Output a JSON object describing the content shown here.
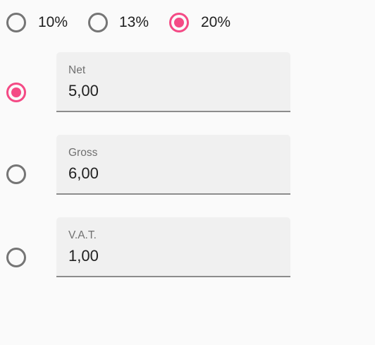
{
  "accent_color": "#f44a85",
  "rates": [
    {
      "label": "10%",
      "selected": false
    },
    {
      "label": "13%",
      "selected": false
    },
    {
      "label": "20%",
      "selected": true
    }
  ],
  "fields": [
    {
      "label": "Net",
      "value": "5,00",
      "selected": true
    },
    {
      "label": "Gross",
      "value": "6,00",
      "selected": false
    },
    {
      "label": "V.A.T.",
      "value": "1,00",
      "selected": false
    }
  ]
}
